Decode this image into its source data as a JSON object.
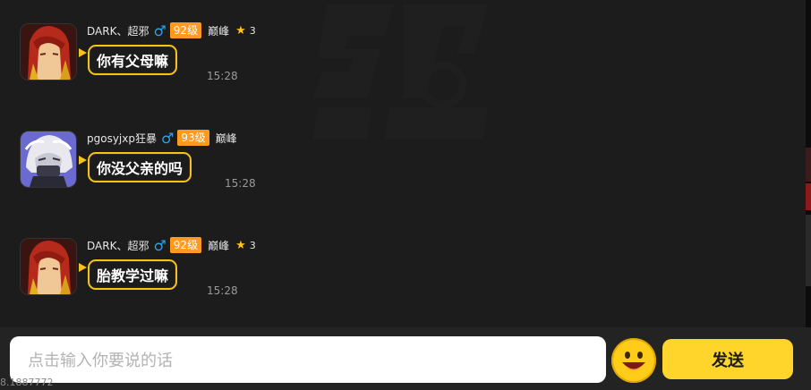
{
  "messages": [
    {
      "username": "DARK、超邪",
      "level": "92级",
      "rank": "巅峰",
      "star_count": "3",
      "text": "你有父母嘛",
      "time": "15:28",
      "avatar_icon": "red-hair-warrior-avatar"
    },
    {
      "username": "pgosyjxp狂暴",
      "level": "93级",
      "rank": "巅峰",
      "star_count": "",
      "text": "你没父亲的吗",
      "time": "15:28",
      "avatar_icon": "white-hair-masked-avatar"
    },
    {
      "username": "DARK、超邪",
      "level": "92级",
      "rank": "巅峰",
      "star_count": "3",
      "text": "胎教学过嘛",
      "time": "15:28",
      "avatar_icon": "red-hair-warrior-avatar"
    }
  ],
  "input": {
    "placeholder": "点击输入你要说的话"
  },
  "send_label": "发送",
  "gender_symbol": "♂",
  "star_symbol": "★",
  "corner_text": "8.1887772",
  "colors": {
    "accent": "#f4c21b",
    "level_badge": "#ff9a1f",
    "gender": "#2ea3e6",
    "send_button": "#ffd52b"
  }
}
